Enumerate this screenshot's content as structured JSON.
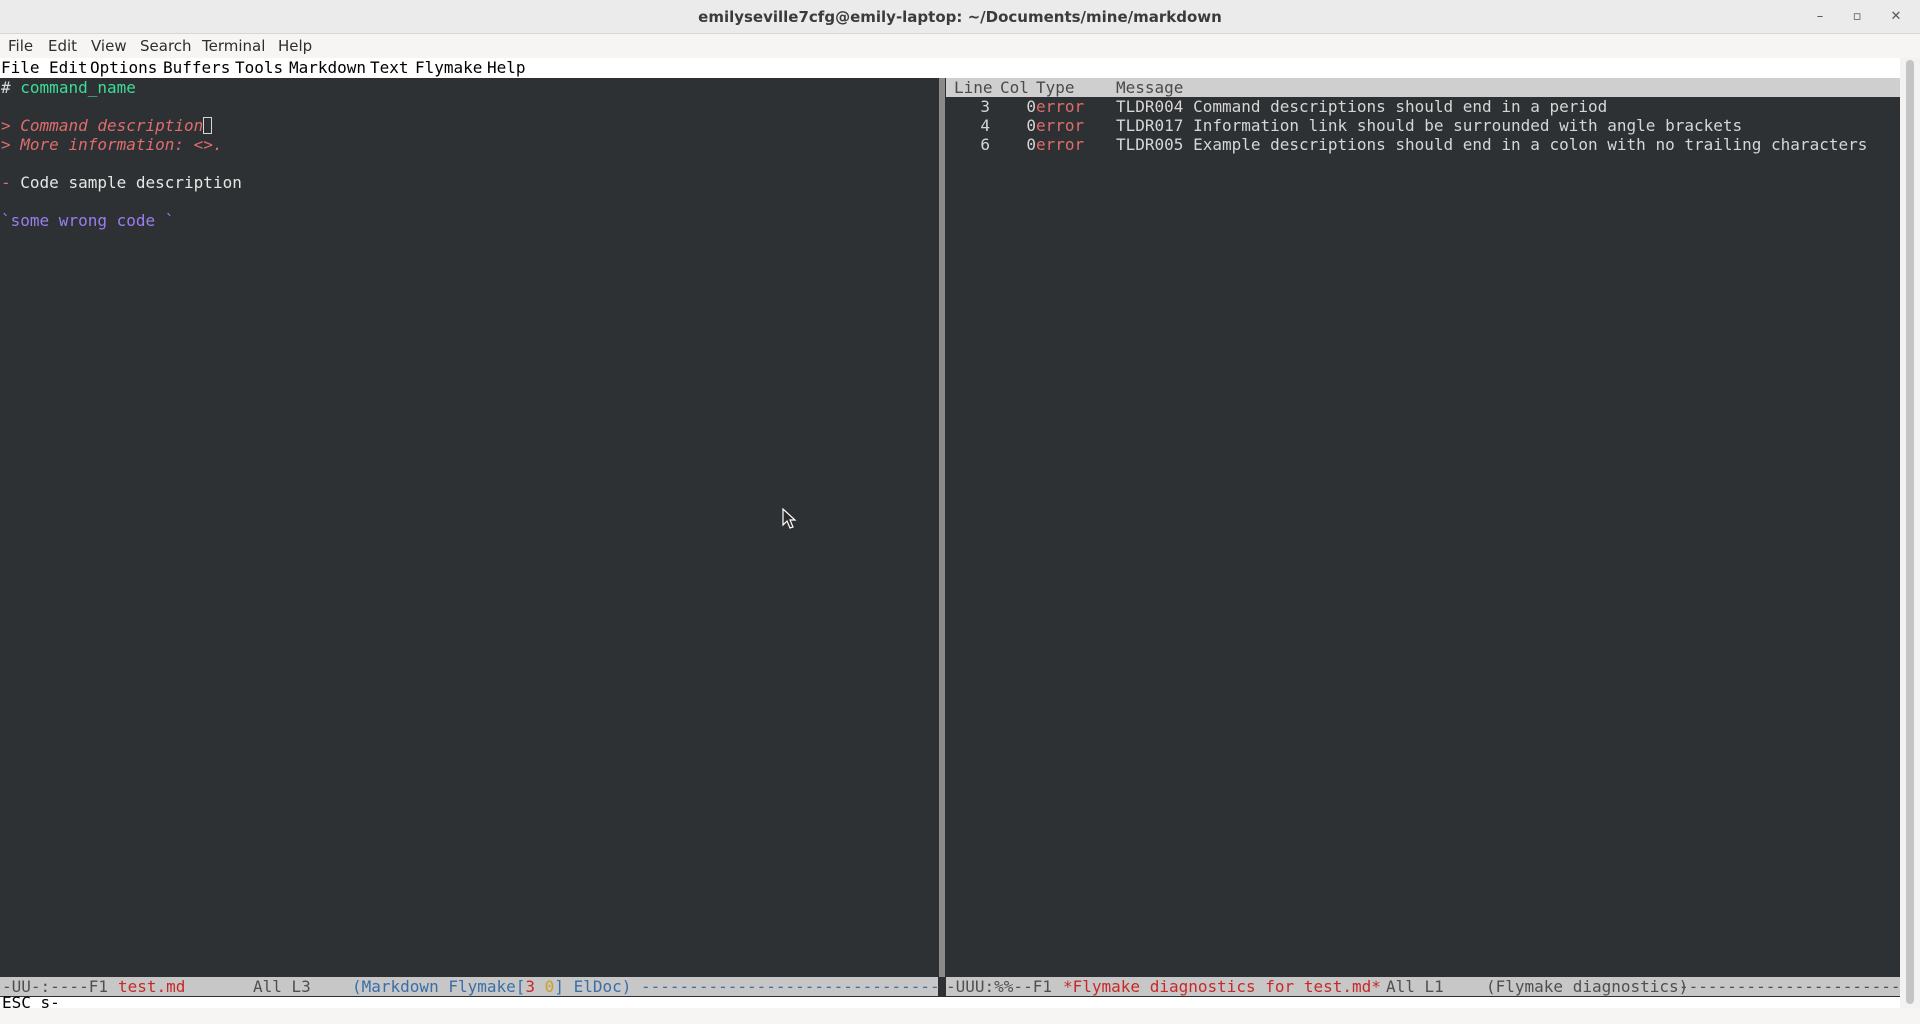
{
  "window": {
    "title": "emilyseville7cfg@emily-laptop: ~/Documents/mine/markdown",
    "controls": {
      "minimize": "–",
      "maximize": "▫",
      "close": "✕"
    }
  },
  "terminal_menu": [
    "File",
    "Edit",
    "View",
    "Search",
    "Terminal",
    "Help"
  ],
  "emacs_menu": [
    "File",
    "Edit",
    "Options",
    "Buffers",
    "Tools",
    "Markdown",
    "Text",
    "Flymake",
    "Help"
  ],
  "editor": {
    "heading_hash": "#",
    "heading_text": "command_name",
    "quote_marker": ">",
    "description": "Command description",
    "more_info": "More information: <>.",
    "list_marker": "-",
    "example_description": "Code sample description",
    "code_tick": "`",
    "code": "some wrong code `"
  },
  "diagnostics": {
    "columns": [
      "Line",
      "Col",
      "Type",
      "Message"
    ],
    "rows": [
      {
        "line": "3",
        "col": "0",
        "type": "error",
        "message": "TLDR004 Command descriptions should end in a period"
      },
      {
        "line": "4",
        "col": "0",
        "type": "error",
        "message": "TLDR017 Information link should be surrounded with angle brackets"
      },
      {
        "line": "6",
        "col": "0",
        "type": "error",
        "message": "TLDR005 Example descriptions should end in a colon with no trailing characters"
      }
    ]
  },
  "modeline_left": {
    "status": "-UU-:----F1",
    "buffer": "test.md",
    "position": "All L3",
    "mode_open": "(Markdown Flymake[",
    "errors": "3",
    "warnings": "0",
    "mode_close": "] ElDoc)",
    "fill": "-------------------------------"
  },
  "modeline_right": {
    "status": "-UUU:%%--F1",
    "buffer": "*Flymake diagnostics for test.md*",
    "position": "All L1",
    "mode": "(Flymake diagnostics)",
    "fill": "-------------------------"
  },
  "echo": "ESC s-",
  "colors": {
    "background": "#2d3133",
    "error": "#e06c6c",
    "heading": "#3ddc97",
    "code": "#9b7cf2",
    "modeline": "#c7c7c7"
  }
}
